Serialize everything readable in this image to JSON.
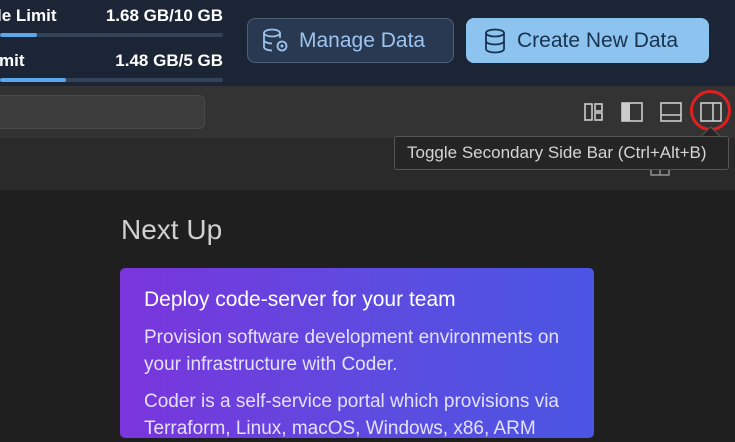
{
  "usage": {
    "rows": [
      {
        "label": "le Limit",
        "value": "1.68 GB/10 GB",
        "fraction": 0.168
      },
      {
        "label": "mit",
        "value": "1.48 GB/5 GB",
        "fraction": 0.296
      }
    ]
  },
  "header_buttons": {
    "manage_label": "Manage Data",
    "create_label": "Create New Data"
  },
  "toolbar": {
    "icons": [
      "customize-layout-icon",
      "toggle-primary-sidebar-icon",
      "toggle-panel-icon",
      "toggle-secondary-sidebar-icon"
    ]
  },
  "tooltip": {
    "text": "Toggle Secondary Side Bar (Ctrl+Alt+B)"
  },
  "welcome": {
    "heading": "Next Up",
    "card": {
      "title": "Deploy code-server for your team",
      "para1": "Provision software development environments on your infrastructure with Coder.",
      "para2": "Coder is a self-service portal which provisions via Terraform, Linux, macOS, Windows, x86, ARM"
    }
  },
  "colors": {
    "topbar": "#1b2536",
    "accent": "#8cc4ef",
    "highlight": "#e02020",
    "card_start": "#7a35dc",
    "card_end": "#4a55e3"
  }
}
